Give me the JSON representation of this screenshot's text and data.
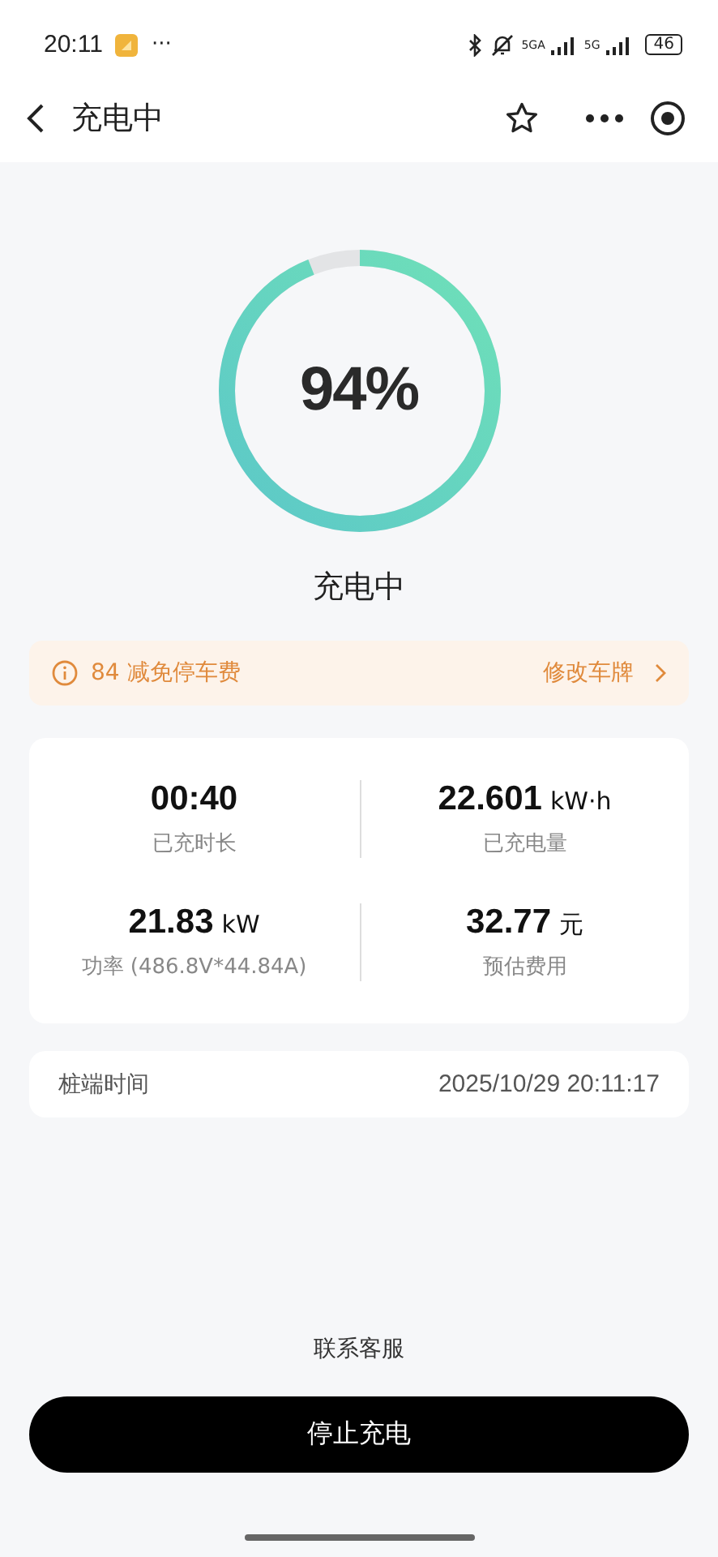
{
  "status_bar": {
    "time": "20:11",
    "more": "···",
    "network_1": "5GA",
    "network_2": "5G",
    "battery": "46"
  },
  "nav": {
    "title": "充电中"
  },
  "progress": {
    "level": 0.94,
    "percent": "94%",
    "status": "充电中"
  },
  "notice": {
    "text": "84 减免停车费",
    "action": "修改车牌"
  },
  "stats": [
    {
      "value": "00:40",
      "label": "已充时长"
    },
    {
      "value": "22.601",
      "unit": "kW·h",
      "label": "已充电量"
    },
    {
      "value": "21.83",
      "unit": "kW",
      "label": "功率 (486.8V*44.84A)"
    },
    {
      "value": "32.77",
      "unit": "元",
      "label": "预估费用"
    }
  ],
  "pile_time": {
    "label": "桩端时间",
    "value": "2025/10/29 20:11:17"
  },
  "contact": "联系客服",
  "stop_button": "停止充电"
}
